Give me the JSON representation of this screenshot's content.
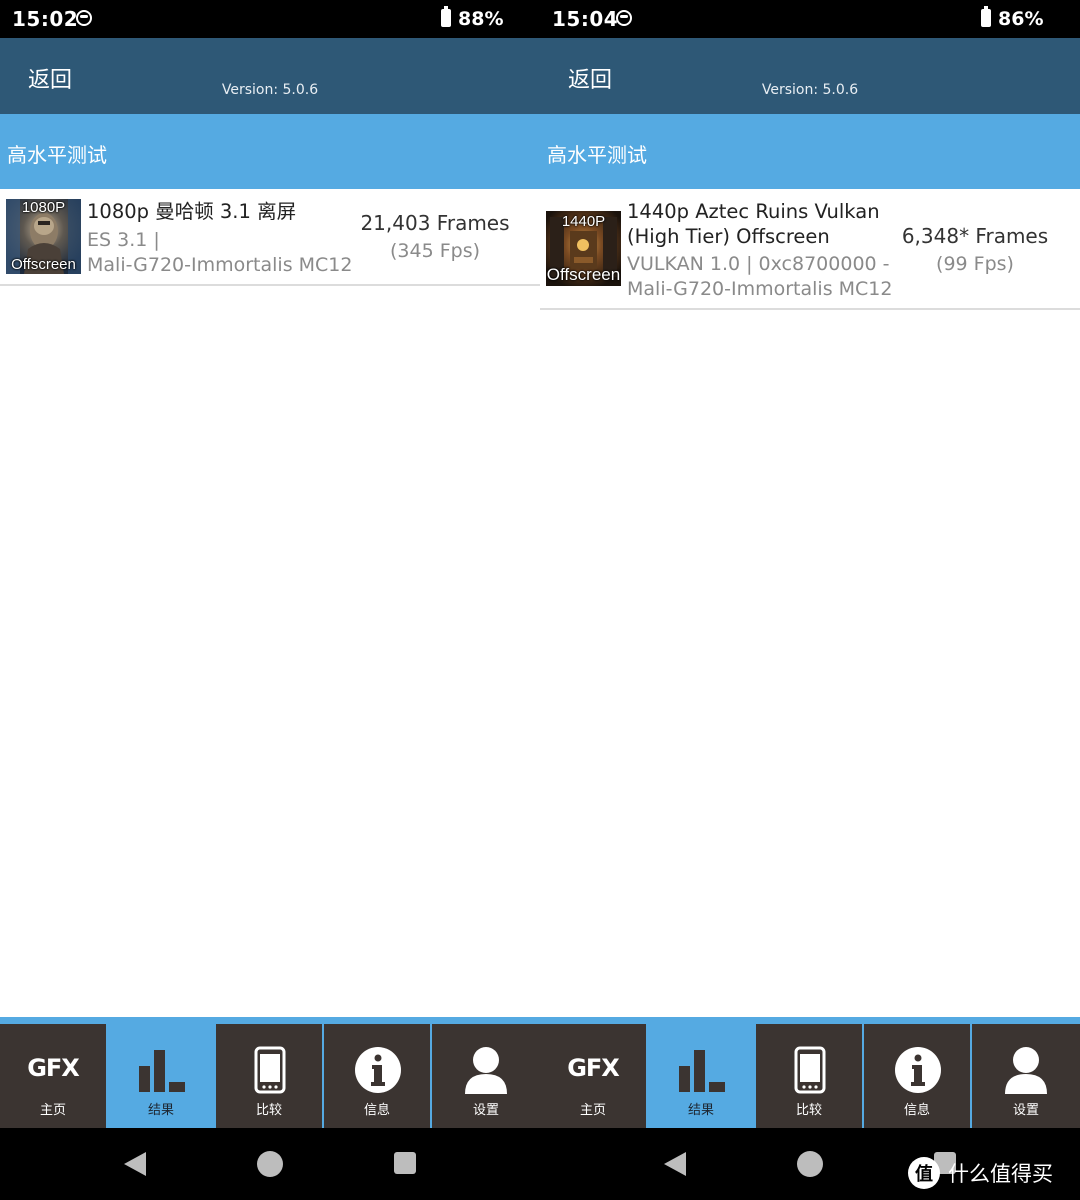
{
  "left": {
    "status": {
      "time": "15:02",
      "battery": "88%"
    },
    "appbar": {
      "back": "返回",
      "version": "Version: 5.0.6"
    },
    "section": "高水平测试",
    "result": {
      "thumb_res": "1080P",
      "thumb_mode": "Offscreen",
      "title_lines": [
        "1080p 曼哈顿 3.1 离屏"
      ],
      "sub_lines": [
        "ES 3.1 |",
        "Mali-G720-Immortalis MC12"
      ],
      "frames": "21,403 Frames",
      "fps": "(345 Fps)"
    },
    "nav": [
      {
        "label": "主页",
        "text": "GFX"
      },
      {
        "label": "结果"
      },
      {
        "label": "比较"
      },
      {
        "label": "信息"
      },
      {
        "label": "设置"
      }
    ]
  },
  "right": {
    "status": {
      "time": "15:04",
      "battery": "86%"
    },
    "appbar": {
      "back": "返回",
      "version": "Version: 5.0.6"
    },
    "section": "高水平测试",
    "result": {
      "thumb_res": "1440P",
      "thumb_mode": "Offscreen",
      "title_lines": [
        "1440p Aztec Ruins Vulkan",
        "(High Tier) Offscreen"
      ],
      "sub_lines": [
        "VULKAN 1.0 | 0xc8700000 -",
        "Mali-G720-Immortalis MC12"
      ],
      "frames": "6,348* Frames",
      "fps": "(99 Fps)"
    },
    "nav": [
      {
        "label": "主页",
        "text": "GFX"
      },
      {
        "label": "结果"
      },
      {
        "label": "比较"
      },
      {
        "label": "信息"
      },
      {
        "label": "设置"
      }
    ]
  },
  "watermark": {
    "logo": "值",
    "text": "什么值得买"
  },
  "colors": {
    "appbar": "#2e5876",
    "section": "#55aae2",
    "nav_bg": "#3b3431",
    "nav_active": "#55aae2"
  },
  "active_tab": "结果"
}
